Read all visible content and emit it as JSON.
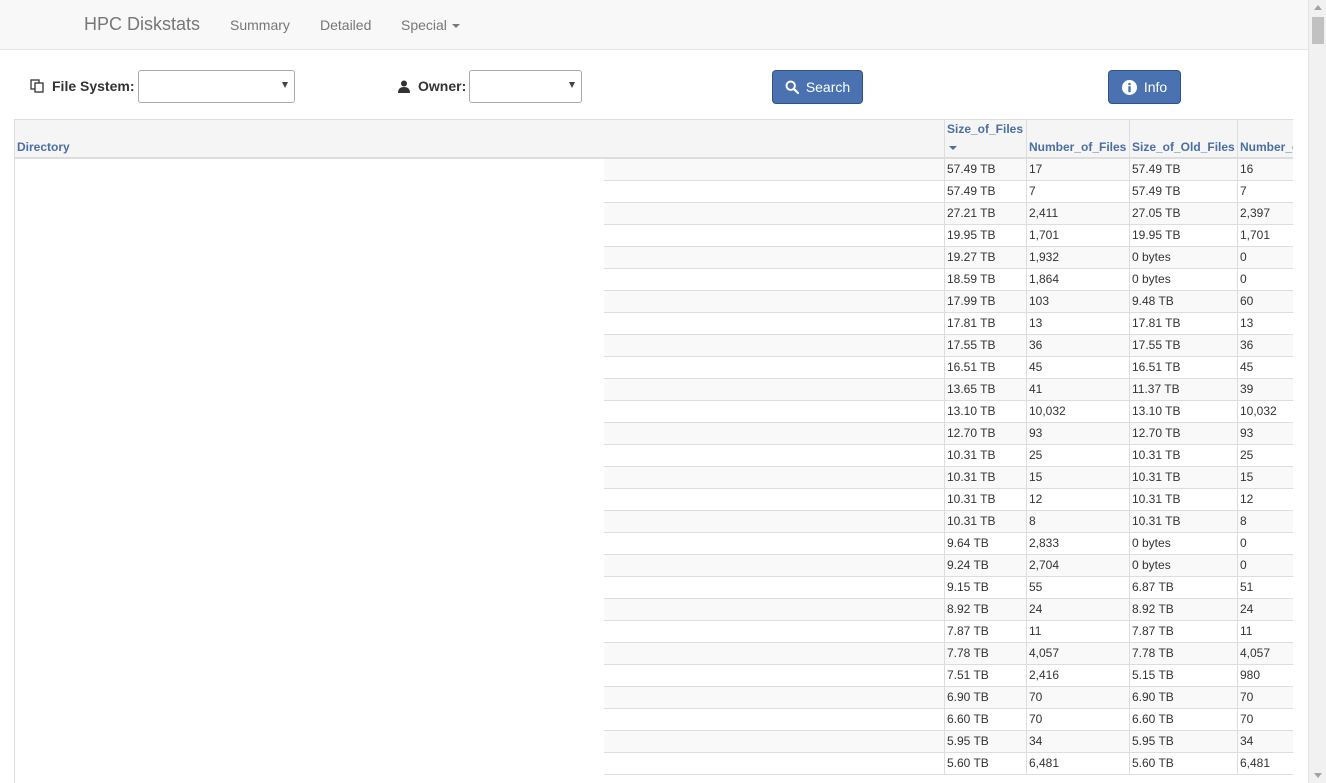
{
  "navbar": {
    "brand": "HPC Diskstats",
    "links": {
      "summary": "Summary",
      "detailed": "Detailed",
      "special": "Special"
    }
  },
  "filters": {
    "file_system_label": "File System:",
    "file_system_value": "",
    "owner_label": "Owner:",
    "owner_value": ""
  },
  "buttons": {
    "search": "Search",
    "info": "Info"
  },
  "colors": {
    "primary_button": "#4b72b0",
    "header_text": "#4a6fa5"
  },
  "table": {
    "columns": {
      "directory": "Directory",
      "size_of_files": "Size_of_Files",
      "number_of_files": "Number_of_Files",
      "size_of_old_files": "Size_of_Old_Files",
      "number_of_old_files": "Number_of_Old_Files"
    },
    "sorted_column": "size_of_files",
    "rows": [
      {
        "size": "57.49 TB",
        "num": "17",
        "old_size": "57.49 TB",
        "old_num": "16"
      },
      {
        "size": "57.49 TB",
        "num": "7",
        "old_size": "57.49 TB",
        "old_num": "7"
      },
      {
        "size": "27.21 TB",
        "num": "2,411",
        "old_size": "27.05 TB",
        "old_num": "2,397"
      },
      {
        "size": "19.95 TB",
        "num": "1,701",
        "old_size": "19.95 TB",
        "old_num": "1,701"
      },
      {
        "size": "19.27 TB",
        "num": "1,932",
        "old_size": "0 bytes",
        "old_num": "0"
      },
      {
        "size": "18.59 TB",
        "num": "1,864",
        "old_size": "0 bytes",
        "old_num": "0"
      },
      {
        "size": "17.99 TB",
        "num": "103",
        "old_size": "9.48 TB",
        "old_num": "60"
      },
      {
        "size": "17.81 TB",
        "num": "13",
        "old_size": "17.81 TB",
        "old_num": "13"
      },
      {
        "size": "17.55 TB",
        "num": "36",
        "old_size": "17.55 TB",
        "old_num": "36"
      },
      {
        "size": "16.51 TB",
        "num": "45",
        "old_size": "16.51 TB",
        "old_num": "45"
      },
      {
        "size": "13.65 TB",
        "num": "41",
        "old_size": "11.37 TB",
        "old_num": "39"
      },
      {
        "size": "13.10 TB",
        "num": "10,032",
        "old_size": "13.10 TB",
        "old_num": "10,032"
      },
      {
        "size": "12.70 TB",
        "num": "93",
        "old_size": "12.70 TB",
        "old_num": "93"
      },
      {
        "size": "10.31 TB",
        "num": "25",
        "old_size": "10.31 TB",
        "old_num": "25"
      },
      {
        "size": "10.31 TB",
        "num": "15",
        "old_size": "10.31 TB",
        "old_num": "15"
      },
      {
        "size": "10.31 TB",
        "num": "12",
        "old_size": "10.31 TB",
        "old_num": "12"
      },
      {
        "size": "10.31 TB",
        "num": "8",
        "old_size": "10.31 TB",
        "old_num": "8"
      },
      {
        "size": "9.64 TB",
        "num": "2,833",
        "old_size": "0 bytes",
        "old_num": "0"
      },
      {
        "size": "9.24 TB",
        "num": "2,704",
        "old_size": "0 bytes",
        "old_num": "0"
      },
      {
        "size": "9.15 TB",
        "num": "55",
        "old_size": "6.87 TB",
        "old_num": "51"
      },
      {
        "size": "8.92 TB",
        "num": "24",
        "old_size": "8.92 TB",
        "old_num": "24"
      },
      {
        "size": "7.87 TB",
        "num": "11",
        "old_size": "7.87 TB",
        "old_num": "11"
      },
      {
        "size": "7.78 TB",
        "num": "4,057",
        "old_size": "7.78 TB",
        "old_num": "4,057"
      },
      {
        "size": "7.51 TB",
        "num": "2,416",
        "old_size": "5.15 TB",
        "old_num": "980"
      },
      {
        "size": "6.90 TB",
        "num": "70",
        "old_size": "6.90 TB",
        "old_num": "70"
      },
      {
        "size": "6.60 TB",
        "num": "70",
        "old_size": "6.60 TB",
        "old_num": "70"
      },
      {
        "size": "5.95 TB",
        "num": "34",
        "old_size": "5.95 TB",
        "old_num": "34"
      },
      {
        "size": "5.60 TB",
        "num": "6,481",
        "old_size": "5.60 TB",
        "old_num": "6,481"
      }
    ]
  }
}
